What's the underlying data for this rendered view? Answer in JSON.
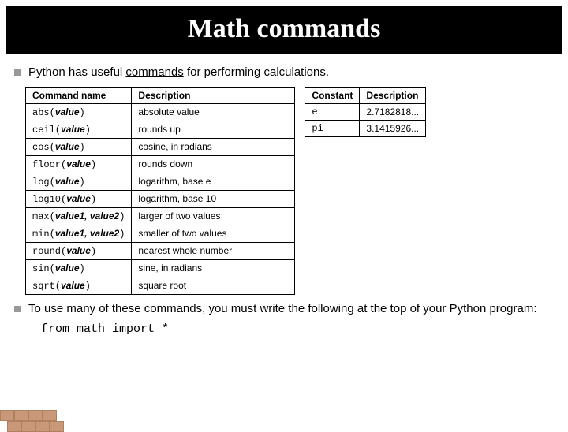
{
  "title": "Math commands",
  "intro_pre": "Python has useful ",
  "intro_underlined": "commands",
  "intro_post": " for performing calculations.",
  "table1": {
    "headers": {
      "col1": "Command name",
      "col2": "Description"
    },
    "rows": [
      {
        "name_pre": "abs(",
        "args": "value",
        "name_post": ")",
        "desc": "absolute value"
      },
      {
        "name_pre": "ceil(",
        "args": "value",
        "name_post": ")",
        "desc": "rounds up"
      },
      {
        "name_pre": "cos(",
        "args": "value",
        "name_post": ")",
        "desc": "cosine, in radians"
      },
      {
        "name_pre": "floor(",
        "args": "value",
        "name_post": ")",
        "desc": "rounds down"
      },
      {
        "name_pre": "log(",
        "args": "value",
        "name_post": ")",
        "desc": "logarithm, base e"
      },
      {
        "name_pre": "log10(",
        "args": "value",
        "name_post": ")",
        "desc": "logarithm, base 10"
      },
      {
        "name_pre": "max(",
        "args": "value1, value2",
        "name_post": ")",
        "desc": "larger of two values"
      },
      {
        "name_pre": "min(",
        "args": "value1, value2",
        "name_post": ")",
        "desc": "smaller of two values"
      },
      {
        "name_pre": "round(",
        "args": "value",
        "name_post": ")",
        "desc": "nearest whole number"
      },
      {
        "name_pre": "sin(",
        "args": "value",
        "name_post": ")",
        "desc": "sine, in radians"
      },
      {
        "name_pre": "sqrt(",
        "args": "value",
        "name_post": ")",
        "desc": "square root"
      }
    ]
  },
  "table2": {
    "headers": {
      "col1": "Constant",
      "col2": "Description"
    },
    "rows": [
      {
        "name": "e",
        "desc": "2.7182818..."
      },
      {
        "name": "pi",
        "desc": "3.1415926..."
      }
    ]
  },
  "outro": "To use many of these commands, you must write the following at the top of your Python program:",
  "code": "from math import *"
}
